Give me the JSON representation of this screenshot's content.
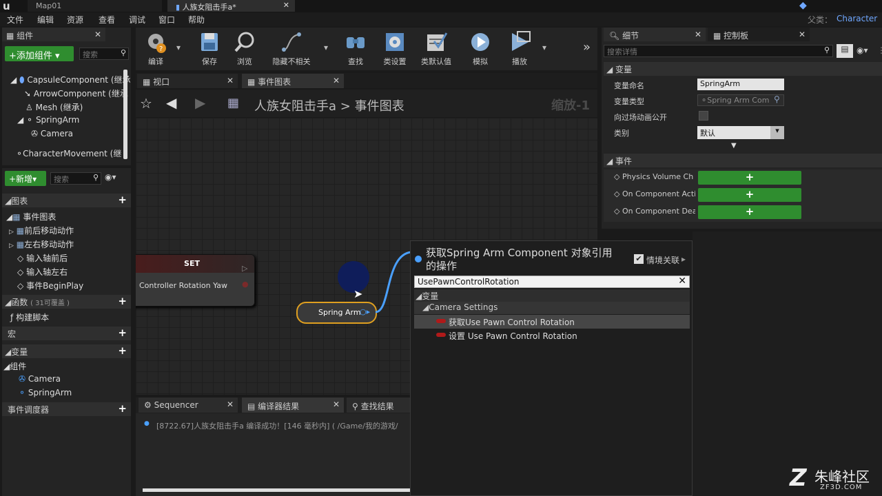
{
  "titlebar": {
    "logo": "u",
    "tabs": [
      "Map01",
      "人族女阻击手a*"
    ],
    "parent_label": "父类：",
    "parent_value": "Character"
  },
  "menu": [
    "文件",
    "编辑",
    "资源",
    "查看",
    "调试",
    "窗口",
    "帮助"
  ],
  "components_panel": {
    "title": "组件",
    "add_button": "+添加组件",
    "search_placeholder": "搜索",
    "tree": [
      "CapsuleComponent (继承",
      "ArrowComponent (继承",
      "Mesh (继承)",
      "SpringArm",
      "Camera",
      "CharacterMovement (继"
    ]
  },
  "mybp_panel": {
    "new_button": "+新增",
    "search_placeholder": "搜索",
    "graphs_label": "图表",
    "event_graph": "事件图表",
    "graph_items": [
      "前后移动动作",
      "左右移动动作",
      "输入轴前后",
      "输入轴左右",
      "事件BeginPlay"
    ],
    "functions_label": "函数",
    "functions_count": "( 31可覆盖 )",
    "construction": "构建脚本",
    "macros_label": "宏",
    "variables_label": "变量",
    "components_label": "组件",
    "variables": [
      "Camera",
      "SpringArm"
    ],
    "dispatchers_label": "事件调度器"
  },
  "toolbar": [
    {
      "label": "编译",
      "icon": "compile-icon"
    },
    {
      "label": "保存",
      "icon": "save-icon"
    },
    {
      "label": "浏览",
      "icon": "browse-icon"
    },
    {
      "label": "隐藏不相关",
      "icon": "hide-unrelated-icon"
    },
    {
      "label": "查找",
      "icon": "find-icon"
    },
    {
      "label": "类设置",
      "icon": "class-settings-icon"
    },
    {
      "label": "类默认值",
      "icon": "class-defaults-icon"
    },
    {
      "label": "模拟",
      "icon": "simulate-icon"
    },
    {
      "label": "播放",
      "icon": "play-icon"
    }
  ],
  "graph_tabs": [
    "视口",
    "事件图表"
  ],
  "breadcrumb": {
    "root": "人族女阻击手a",
    "sep": ">",
    "leaf": "事件图表",
    "zoom": "缩放-1"
  },
  "set_node": {
    "title": "SET",
    "pin": "Controller Rotation Yaw"
  },
  "springarm_node": {
    "label": "Spring Arm"
  },
  "context_menu": {
    "title": "获取Spring Arm Component 对象引用的操作",
    "context_sensitive": "情境关联",
    "search_value": "UsePawnControlRotation",
    "category": "变量",
    "subcategory": "Camera Settings",
    "items": [
      "获取Use Pawn Control Rotation",
      "设置 Use Pawn Control Rotation"
    ]
  },
  "bottom_tabs": [
    "Sequencer",
    "编译器结果",
    "查找结果"
  ],
  "compiler_log": "[8722.67]人族女阻击手a 编译成功！[146 毫秒内] ( /Game/我的游戏/",
  "details_panel": {
    "tab_details": "细节",
    "tab_palette": "控制板",
    "search_placeholder": "搜索详情",
    "variable_section": "变量",
    "rows": [
      {
        "label": "变量命名",
        "value": "SpringArm"
      },
      {
        "label": "变量类型",
        "value": "Spring Arm Com"
      },
      {
        "label": "向过场动画公开",
        "value": ""
      },
      {
        "label": "类别",
        "value": "默认"
      }
    ],
    "events_section": "事件",
    "events": [
      "Physics Volume Ch",
      "On Component Acti",
      "On Component Dea"
    ]
  },
  "watermark": {
    "logo": "Z",
    "name": "朱峰社区",
    "url": "ZF3D.COM"
  },
  "colors": {
    "accent_green": "#2f8d2f",
    "node_orange": "#e0a020",
    "selection_blue": "#1a2a6a"
  }
}
